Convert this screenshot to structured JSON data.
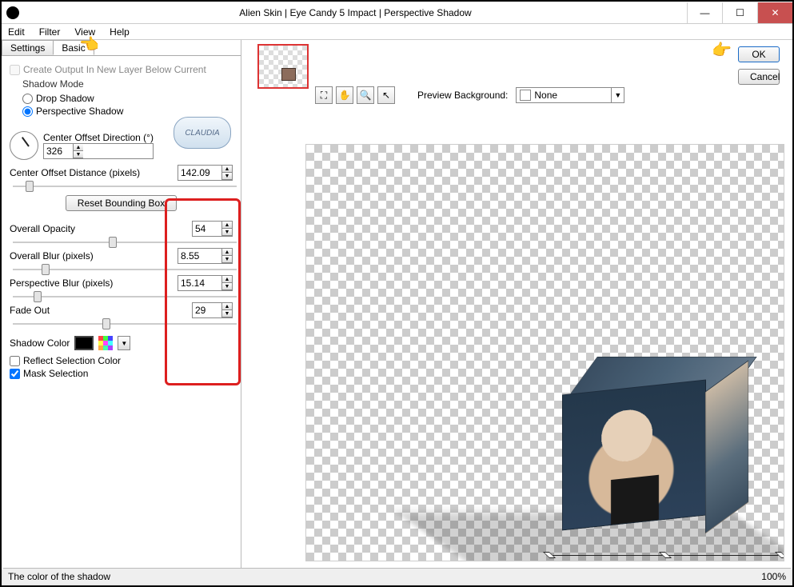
{
  "title": "Alien Skin | Eye Candy 5 Impact | Perspective Shadow",
  "menu": {
    "edit": "Edit",
    "filter": "Filter",
    "view": "View",
    "help": "Help"
  },
  "win": {
    "min": "—",
    "max": "☐",
    "close": "✕"
  },
  "tabs": {
    "settings": "Settings",
    "basic": "Basic"
  },
  "createOutput": "Create Output In New Layer Below Current",
  "shadowMode": "Shadow Mode",
  "radio": {
    "drop": "Drop Shadow",
    "persp": "Perspective Shadow"
  },
  "claudia": "CLAUDIA",
  "dir": {
    "label": "Center Offset Direction (°)",
    "value": "326"
  },
  "dist": {
    "label": "Center Offset Distance (pixels)",
    "value": "142.09"
  },
  "resetBox": "Reset Bounding Box",
  "opacity": {
    "label": "Overall Opacity",
    "value": "54"
  },
  "blur": {
    "label": "Overall Blur (pixels)",
    "value": "8.55"
  },
  "pblur": {
    "label": "Perspective Blur (pixels)",
    "value": "15.14"
  },
  "fade": {
    "label": "Fade Out",
    "value": "29"
  },
  "shadowColor": "Shadow Color",
  "reflect": "Reflect Selection Color",
  "mask": "Mask Selection",
  "pvbg": {
    "label": "Preview Background:",
    "value": "None"
  },
  "buttons": {
    "ok": "OK",
    "cancel": "Cancel"
  },
  "status": {
    "left": "The color of the shadow",
    "right": "100%"
  },
  "arrows": {
    "up": "▲",
    "dn": "▼"
  },
  "tools": {
    "fit": "⛶",
    "hand": "✋",
    "zoom": "🔍",
    "arrow": "↖"
  }
}
